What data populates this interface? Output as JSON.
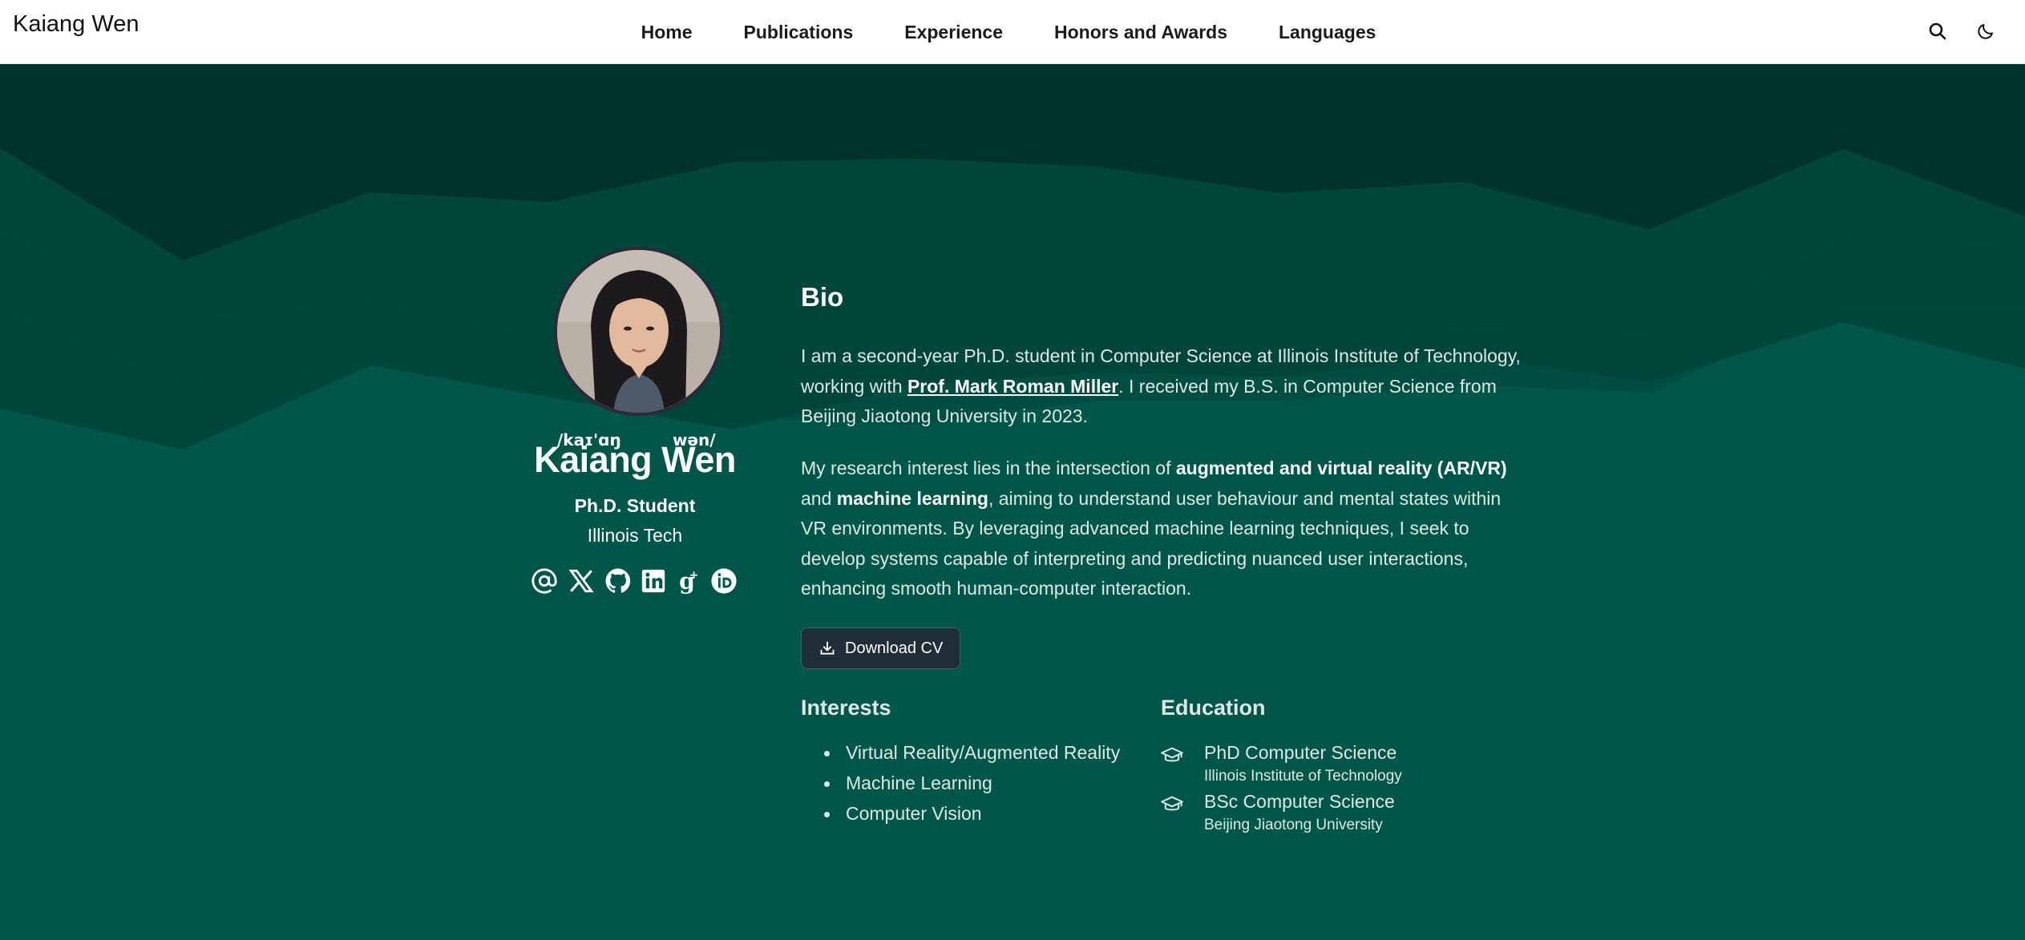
{
  "navbar": {
    "brand": "Kaiang Wen",
    "links": [
      "Home",
      "Publications",
      "Experience",
      "Honors and Awards",
      "Languages"
    ],
    "search_icon": "search-icon",
    "theme_icon": "moon-icon"
  },
  "profile": {
    "phonetic_first": "/kaɪ'ɑŋ",
    "phonetic_last": "wən/",
    "name": "Kaiang Wen",
    "role": "Ph.D. Student",
    "organization": "Illinois Tech",
    "social_icons": [
      "at-sign-icon",
      "x-icon",
      "github-icon",
      "linkedin-icon",
      "google-scholar-icon",
      "orcid-icon"
    ]
  },
  "bio": {
    "title": "Bio",
    "p1_before": "I am a second-year Ph.D. student in Computer Science at Illinois Institute of Technology, working with ",
    "p1_link": "Prof. Mark Roman Miller",
    "p1_after": ". I received my B.S. in Computer Science from Beijing Jiaotong University in 2023.",
    "p2_a": "My research interest lies in the intersection of ",
    "p2_b": "augmented and virtual reality (AR/VR)",
    "p2_c": " and ",
    "p2_d": "machine learning",
    "p2_e": ", aiming to understand user behaviour and mental states within VR environments. By leveraging advanced machine learning techniques, I seek to develop systems capable of interpreting and predicting nuanced user interactions, enhancing smooth human-computer interaction.",
    "cv_label": "Download CV"
  },
  "interests": {
    "title": "Interests",
    "items": [
      "Virtual Reality/Augmented Reality",
      "Machine Learning",
      "Computer Vision"
    ]
  },
  "education": {
    "title": "Education",
    "items": [
      {
        "degree": "PhD Computer Science",
        "school": "Illinois Institute of Technology"
      },
      {
        "degree": "BSc Computer Science",
        "school": "Beijing Jiaotong University"
      }
    ]
  },
  "colors": {
    "hero_dark": "#00332A",
    "hero_mid": "#00463B",
    "hero_light": "#005749",
    "button_bg": "#1F2D38"
  }
}
